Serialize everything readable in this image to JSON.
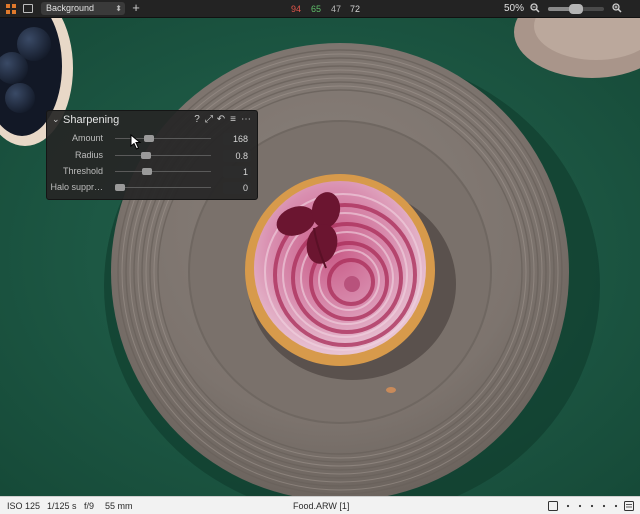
{
  "toolbar": {
    "layer_name": "Background",
    "stats": [
      {
        "value": "94",
        "color": "#e0554a"
      },
      {
        "value": "65",
        "color": "#5fbf6a"
      },
      {
        "value": "47",
        "color": "#b7b7b7"
      },
      {
        "value": "72",
        "color": "#d6d6d6"
      }
    ],
    "zoom": "50%",
    "zoom_level": 0.5,
    "accent_color": "#e07a2c"
  },
  "sharpening": {
    "title": "Sharpening",
    "sliders": [
      {
        "label": "Amount",
        "value": "168",
        "level": 0.34
      },
      {
        "label": "Radius",
        "value": "0.8",
        "level": 0.3
      },
      {
        "label": "Threshold",
        "value": "1",
        "level": 0.31
      },
      {
        "label": "Halo suppr…",
        "value": "0",
        "level": 0.0
      }
    ]
  },
  "status": {
    "iso": "ISO 125",
    "shutter": "1/125 s",
    "aperture": "f/9",
    "focal_length": "55 mm",
    "filename": "Food.ARW [1]"
  }
}
